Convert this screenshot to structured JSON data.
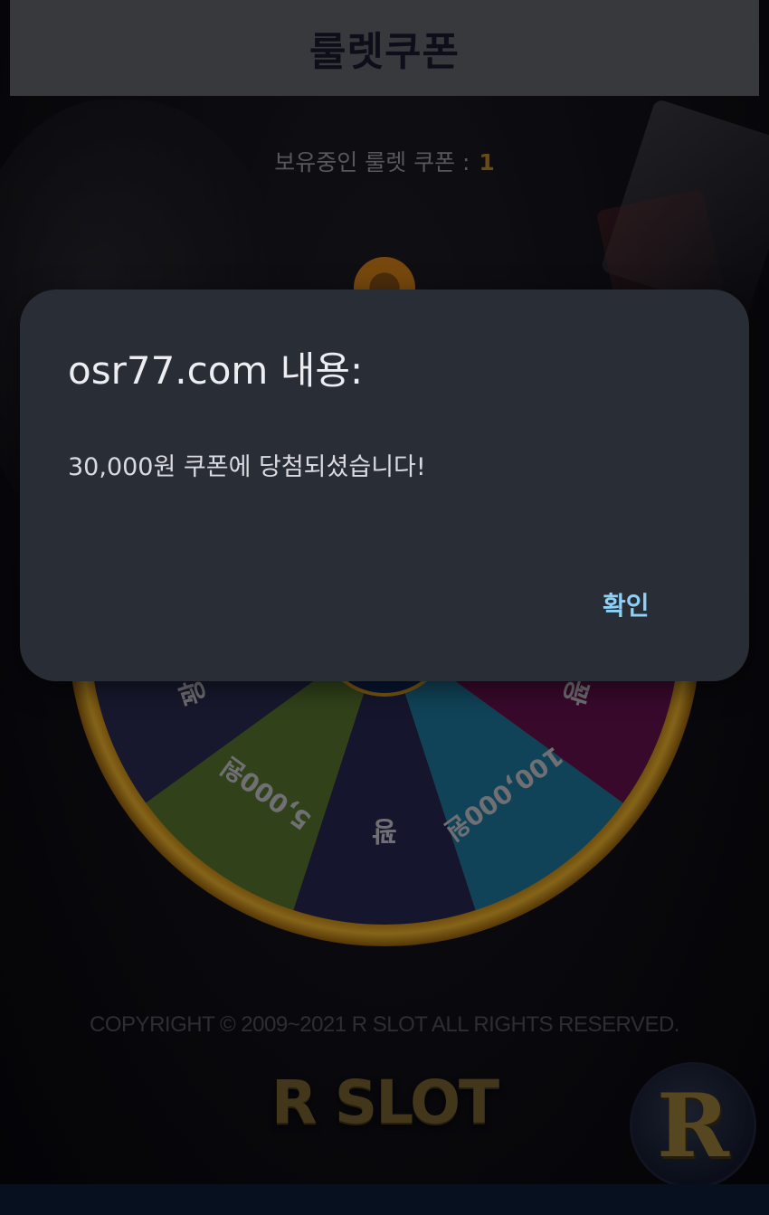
{
  "header": {
    "title": "룰렛쿠폰"
  },
  "coupon_count": {
    "label": "보유중인 룰렛 쿠폰 : ",
    "value": "1"
  },
  "wheel": {
    "segments": [
      {
        "label": "꽝",
        "color": "#26284a"
      },
      {
        "label": "5,000원",
        "color": "#4f6b2b"
      },
      {
        "label": "꽝",
        "color": "#22254a"
      },
      {
        "label": "100,000원",
        "color": "#1a6d8e"
      },
      {
        "label": "꽝",
        "color": "#5c0f47"
      }
    ],
    "rim_color": "#c28d1c"
  },
  "footer": {
    "copyright": "COPYRIGHT © 2009~2021 R SLOT ALL RIGHTS RESERVED.",
    "logo": "R SLOT",
    "badge_letter": "R"
  },
  "dialog": {
    "title": "osr77.com 내용:",
    "message": "30,000원 쿠폰에 당첨되셨습니다!",
    "ok_label": "확인"
  }
}
